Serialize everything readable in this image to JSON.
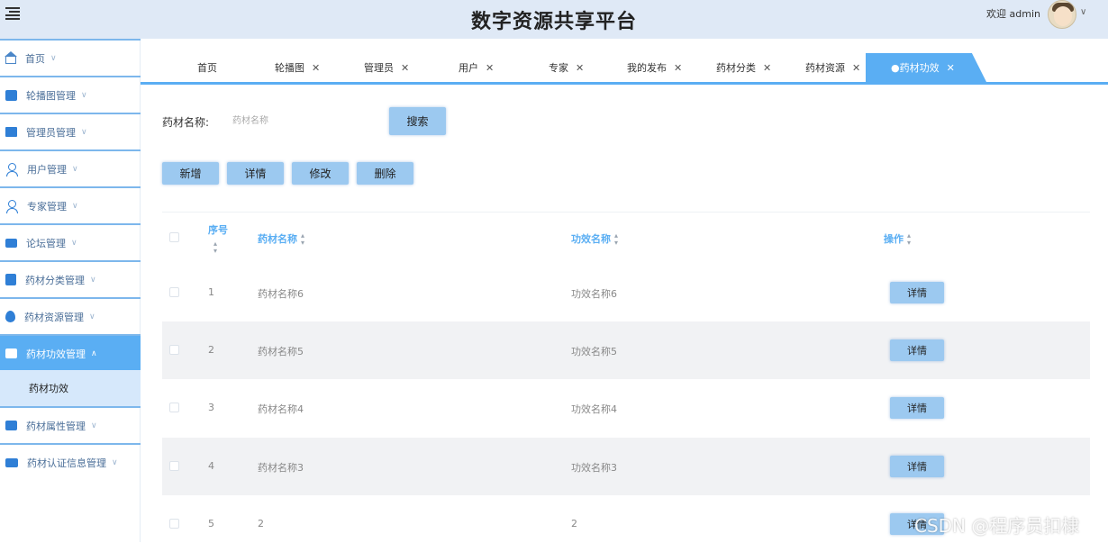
{
  "header": {
    "title": "数字资源共享平台",
    "welcome": "欢迎 admin"
  },
  "sidebar": {
    "items": [
      {
        "label": "首页",
        "icon": "home-icon"
      },
      {
        "label": "轮播图管理",
        "icon": "carousel-icon"
      },
      {
        "label": "管理员管理",
        "icon": "briefcase-icon"
      },
      {
        "label": "用户管理",
        "icon": "user-icon"
      },
      {
        "label": "专家管理",
        "icon": "user-icon"
      },
      {
        "label": "论坛管理",
        "icon": "forum-icon"
      },
      {
        "label": "药材分类管理",
        "icon": "book-icon"
      },
      {
        "label": "药材资源管理",
        "icon": "drop-icon"
      },
      {
        "label": "药材功效管理",
        "icon": "box-icon",
        "active": true
      },
      {
        "label": "药材属性管理",
        "icon": "card-icon"
      },
      {
        "label": "药材认证信息管理",
        "icon": "laptop-icon"
      }
    ],
    "sub_item": "药材功效"
  },
  "tabs": [
    {
      "label": "首页"
    },
    {
      "label": "轮播图"
    },
    {
      "label": "管理员"
    },
    {
      "label": "用户"
    },
    {
      "label": "专家"
    },
    {
      "label": "我的发布"
    },
    {
      "label": "药材分类"
    },
    {
      "label": "药材资源"
    },
    {
      "label": "●药材功效",
      "active": true
    }
  ],
  "search": {
    "label": "药材名称:",
    "placeholder": "药材名称",
    "button": "搜索"
  },
  "actions": {
    "add": "新增",
    "detail": "详情",
    "edit": "修改",
    "delete": "删除"
  },
  "table": {
    "headers": {
      "index": "序号",
      "name": "药材名称",
      "effect": "功效名称",
      "op": "操作"
    },
    "rows": [
      {
        "index": "1",
        "name": "药材名称6",
        "effect": "功效名称6",
        "action": "详情"
      },
      {
        "index": "2",
        "name": "药材名称5",
        "effect": "功效名称5",
        "action": "详情"
      },
      {
        "index": "3",
        "name": "药材名称4",
        "effect": "功效名称4",
        "action": "详情"
      },
      {
        "index": "4",
        "name": "药材名称3",
        "effect": "功效名称3",
        "action": "详情"
      },
      {
        "index": "5",
        "name": "2",
        "effect": "2",
        "action": "详情"
      }
    ]
  },
  "watermark": "CSDN @程序员扣棣",
  "colors": {
    "header_bg": "#dfe9f6",
    "accent": "#5aaef3",
    "button_bg": "#9cc9f0",
    "sidebar_active": "#5aaef3",
    "sidebar_sub": "#d6e8fb"
  }
}
